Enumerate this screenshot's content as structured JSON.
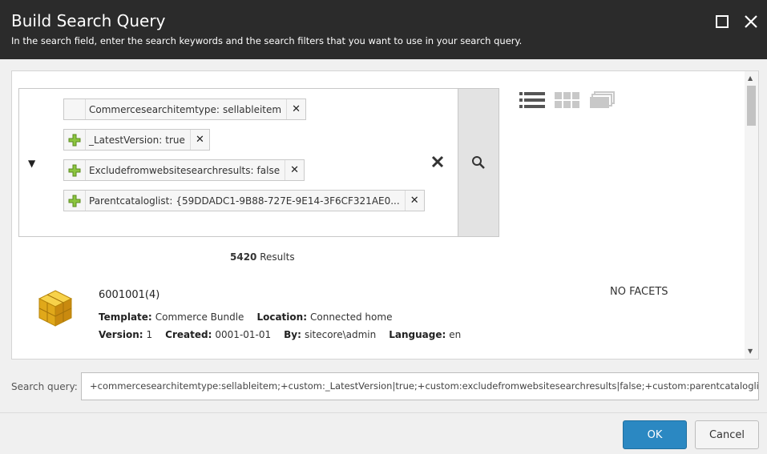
{
  "dialog": {
    "title": "Build Search Query",
    "subtitle": "In the search field, enter the search keywords and the search filters that you want to use in your search query."
  },
  "filters": [
    {
      "key": "Commercesearchitemtype:",
      "value": "sellableitem",
      "icon": "none"
    },
    {
      "key": "_LatestVersion:",
      "value": "true",
      "icon": "add-icon"
    },
    {
      "key": "Excludefromwebsitesearchresults:",
      "value": "false",
      "icon": "add-icon"
    },
    {
      "key": "Parentcataloglist:",
      "value": "{59DDADC1-9B88-727E-9E14-3F6CF321AE0...",
      "icon": "add-icon"
    }
  ],
  "results": {
    "count": "5420",
    "label": "Results",
    "items": [
      {
        "name": "6001001",
        "versions": "(4)",
        "template_label": "Template:",
        "template": "Commerce Bundle",
        "location_label": "Location:",
        "location": "Connected home",
        "version_label": "Version:",
        "version": "1",
        "created_label": "Created:",
        "created": "0001-01-01",
        "by_label": "By:",
        "by": "sitecore\\admin",
        "language_label": "Language:",
        "language": "en"
      }
    ]
  },
  "facets": {
    "empty_label": "NO FACETS"
  },
  "query": {
    "label": "Search query:",
    "value": "+commercesearchitemtype:sellableitem;+custom:_LatestVersion|true;+custom:excludefromwebsitesearchresults|false;+custom:parentcataloglist|"
  },
  "buttons": {
    "ok": "OK",
    "cancel": "Cancel"
  },
  "colors": {
    "titlebar": "#2b2b2b",
    "accent": "#2b88c2"
  }
}
